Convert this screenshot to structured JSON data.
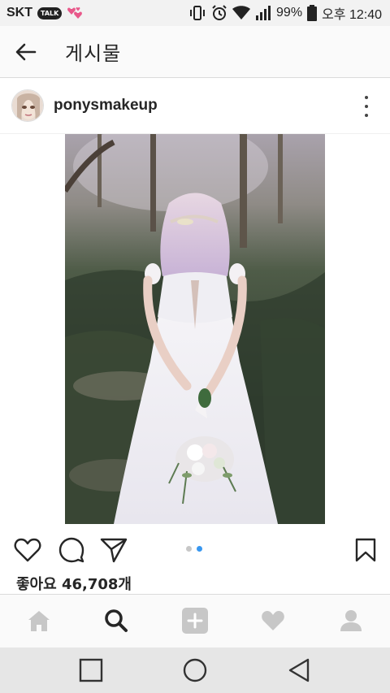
{
  "status_bar": {
    "carrier": "SKT",
    "talk_badge": "TALK",
    "battery": "99%",
    "time": "오후 12:40"
  },
  "header": {
    "title": "게시물",
    "back_icon": "arrow-left-icon"
  },
  "post": {
    "username": "ponysmakeup",
    "more_icon": "more-vertical-icon",
    "image_icon": "wedding-photo",
    "carousel": {
      "total": 2,
      "current": 2
    },
    "likes_text": "좋아요 46,708개"
  },
  "actions": {
    "icons": [
      "heart-icon",
      "comment-icon",
      "share-icon",
      "bookmark-icon"
    ]
  },
  "bottom_nav": {
    "items": [
      "home-icon",
      "search-icon",
      "add-icon",
      "activity-icon",
      "profile-icon"
    ],
    "active": "search-icon"
  },
  "system_nav": {
    "items": [
      "recent-apps-icon",
      "home-circle-icon",
      "back-triangle-icon"
    ]
  },
  "colors": {
    "accent": "#3897f0",
    "text": "#262626",
    "icon_inactive": "#c7c7c7"
  }
}
